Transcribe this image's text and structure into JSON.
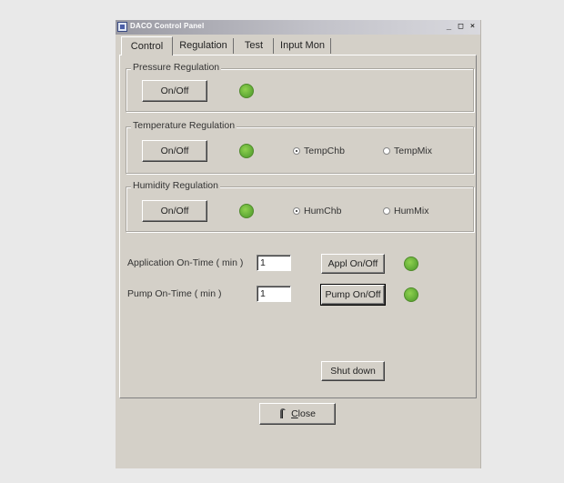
{
  "window": {
    "title": "DACO Control Panel",
    "controls": [
      "_",
      "□",
      "×"
    ]
  },
  "tabs": [
    {
      "label": "Control",
      "active": true
    },
    {
      "label": "Regulation",
      "active": false
    },
    {
      "label": "Test",
      "active": false
    },
    {
      "label": "Input Mon",
      "active": false
    }
  ],
  "pressure": {
    "title": "Pressure Regulation",
    "button": "On/Off",
    "led_color": "#6ab33c"
  },
  "temperature": {
    "title": "Temperature Regulation",
    "button": "On/Off",
    "radio1": "TempChb",
    "radio2": "TempMix",
    "selected": "TempChb"
  },
  "humidity": {
    "title": "Humidity Regulation",
    "button": "On/Off",
    "radio1": "HumChb",
    "radio2": "HumMix",
    "selected": "HumChb"
  },
  "application": {
    "label": "Application On-Time ( min )",
    "value": "1",
    "button": "Appl On/Off"
  },
  "pump": {
    "label": "Pump On-Time ( min )",
    "value": "1",
    "button": "Pump On/Off"
  },
  "shutdown": {
    "button": "Shut down"
  },
  "close": {
    "label_ul": "C",
    "label_rest": "lose"
  },
  "icons": {
    "close_button": "door-exit-icon",
    "status": "status-led-icon"
  }
}
